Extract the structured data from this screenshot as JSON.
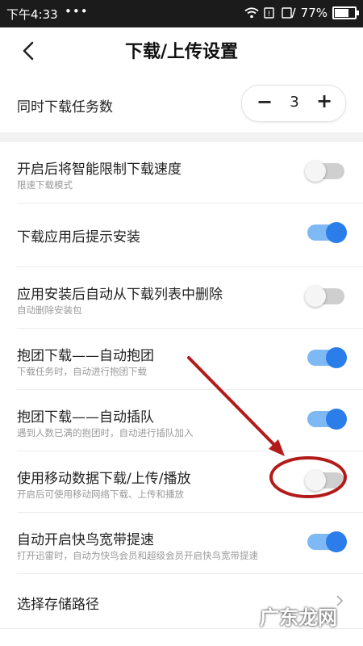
{
  "status_bar": {
    "time": "下午4:33",
    "dots": "•••",
    "battery": "77%"
  },
  "header": {
    "title": "下载/上传设置"
  },
  "concurrent": {
    "label": "同时下载任务数",
    "minus": "−",
    "value": "3",
    "plus": "+"
  },
  "settings": [
    {
      "title": "开启后将智能限制下载速度",
      "subtitle": "限速下载模式",
      "enabled": false
    },
    {
      "title": "下载应用后提示安装",
      "subtitle": "",
      "enabled": true
    },
    {
      "title": "应用安装后自动从下载列表中删除",
      "subtitle": "自动删除安装包",
      "enabled": false
    },
    {
      "title": "抱团下载——自动抱团",
      "subtitle": "下载任务时，自动进行抱团下载",
      "enabled": true
    },
    {
      "title": "抱团下载——自动插队",
      "subtitle": "遇到人数已满的抱团时，自动进行插队加入",
      "enabled": true
    },
    {
      "title": "使用移动数据下载/上传/播放",
      "subtitle": "开启后可使用移动网络下载、上传和播放",
      "enabled": false
    },
    {
      "title": "自动开启快鸟宽带提速",
      "subtitle": "打开迅雷时，自动为快鸟会员和超级会员开启快鸟宽带提速",
      "enabled": true
    }
  ],
  "storage_path": {
    "label": "选择存储路径"
  },
  "watermark": "广东龙网",
  "colors": {
    "toggle_on_knob": "#2b7de9",
    "toggle_on_track": "#7eb8f5",
    "toggle_off_track": "#cfcfcf",
    "annotation": "#b31b1b"
  }
}
